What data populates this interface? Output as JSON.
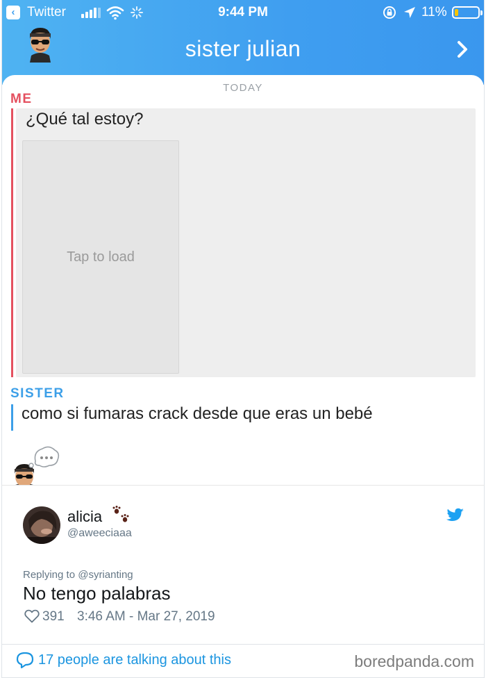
{
  "status_bar": {
    "back_app": "Twitter",
    "time": "9:44 PM",
    "battery": "11%",
    "battery_level": 0.11
  },
  "chat_header": {
    "contact_name": "sister julian"
  },
  "chat": {
    "date_divider": "TODAY",
    "messages": [
      {
        "sender": "ME",
        "text": "¿Qué tal estoy?",
        "media_label": "Tap to load"
      },
      {
        "sender": "SISTER",
        "text": "como si fumaras crack desde que eras un bebé"
      }
    ]
  },
  "tweet": {
    "name": "alicia",
    "handle": "@aweeciaaa",
    "replying_to": "Replying to @syrianting",
    "text": "No tengo palabras",
    "likes": "391",
    "timestamp": "3:46 AM - Mar 27, 2019",
    "conversation_link": "17 people are talking about this"
  },
  "watermark": "boredpanda.com",
  "colors": {
    "header_blue": "#3f9ef0",
    "me_red": "#e4505f",
    "sister_blue": "#3c9fe8",
    "twitter_blue": "#1da1f2"
  },
  "icons": [
    "back-icon",
    "signal-icon",
    "wifi-icon",
    "spinner-icon",
    "lock-rotation-icon",
    "location-icon",
    "battery-icon",
    "bitmoji-avatar-icon",
    "chevron-right-icon",
    "typing-bubble-icon",
    "paw-prints-icon",
    "twitter-bird-icon",
    "heart-icon",
    "comment-icon"
  ]
}
